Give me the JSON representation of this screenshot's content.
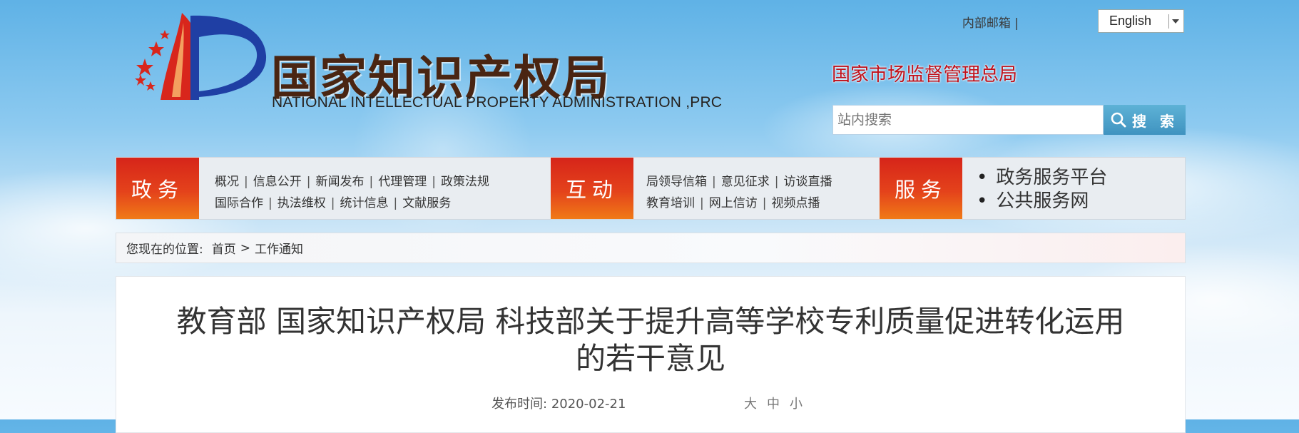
{
  "header": {
    "logo_cn": "国家知识产权局",
    "logo_en": "NATIONAL INTELLECTUAL PROPERTY ADMINISTRATION ,PRC",
    "mailbox_link": "内部邮箱 |",
    "language": {
      "selected": "English"
    },
    "parent_agency": "国家市场监督管理总局",
    "search": {
      "placeholder": "站内搜索",
      "button_label": "搜 索"
    }
  },
  "nav": {
    "sections": [
      {
        "label": "政务",
        "rows": [
          [
            "概况",
            "信息公开",
            "新闻发布",
            "代理管理",
            "政策法规"
          ],
          [
            "国际合作",
            "执法维权",
            "统计信息",
            "文献服务"
          ]
        ]
      },
      {
        "label": "互动",
        "rows": [
          [
            "局领导信箱",
            "意见征求",
            "访谈直播"
          ],
          [
            "教育培训",
            "网上信访",
            "视频点播"
          ]
        ]
      },
      {
        "label": "服务",
        "items": [
          "政务服务平台",
          "公共服务网"
        ]
      }
    ]
  },
  "breadcrumb": {
    "prefix": "您现在的位置:",
    "home": "首页",
    "separator": ">",
    "current": "工作通知"
  },
  "article": {
    "title_line1": "教育部 国家知识产权局 科技部关于提升高等学校专利质量促进转化运用",
    "title_line2": "的若干意见",
    "publish_label": "发布时间:",
    "publish_date": "2020-02-21",
    "font_sizes": [
      "大",
      "中",
      "小"
    ]
  },
  "colors": {
    "nav_block_top": "#d6251a",
    "nav_block_bottom": "#f07a17",
    "search_button": "#4aa0c9",
    "parent_agency_text": "#c0101a"
  }
}
